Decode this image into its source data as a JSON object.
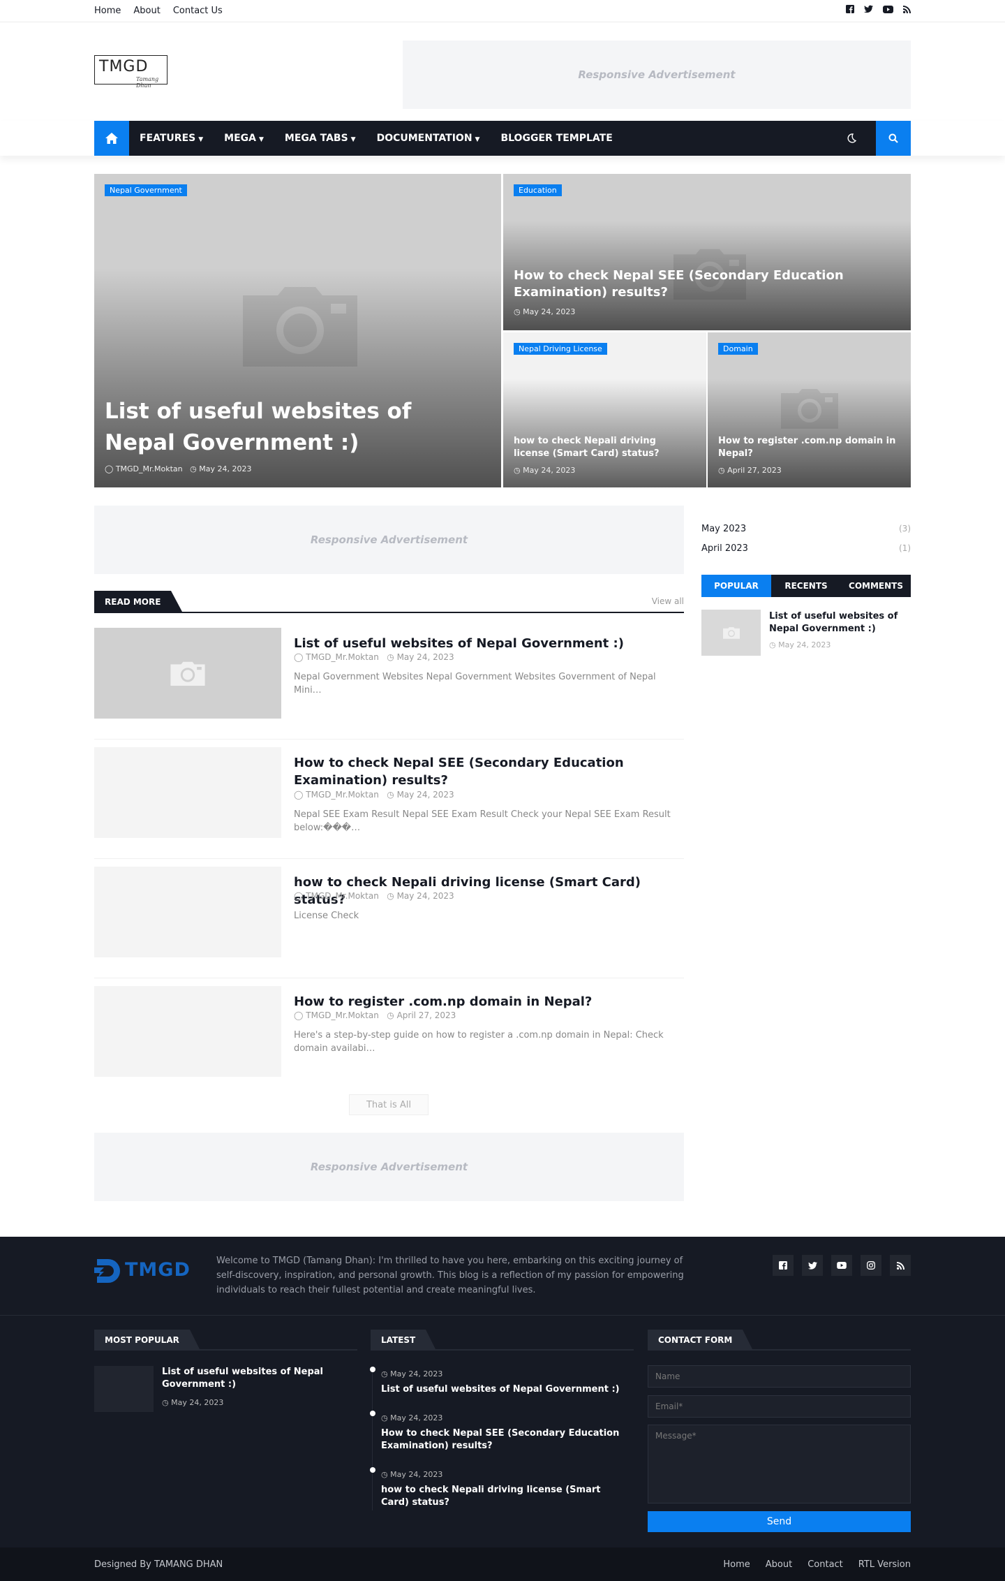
{
  "topbar": {
    "links": [
      "Home",
      "About",
      "Contact Us"
    ],
    "social": [
      "facebook-icon",
      "twitter-icon",
      "youtube-icon",
      "rss-icon"
    ]
  },
  "header": {
    "logo_text": "TMGD",
    "logo_script": "Tamang Dhan",
    "ad_text": "Responsive Advertisement"
  },
  "nav": {
    "items": [
      {
        "label": "FEATURES",
        "dropdown": true
      },
      {
        "label": "MEGA",
        "dropdown": true
      },
      {
        "label": "MEGA TABS",
        "dropdown": true
      },
      {
        "label": "DOCUMENTATION",
        "dropdown": true
      },
      {
        "label": "BLOGGER TEMPLATE",
        "dropdown": false
      }
    ],
    "accent": "#0a7ff0"
  },
  "featured": [
    {
      "label": "Nepal Government",
      "title": "List of useful websites of Nepal Government :)",
      "author": "TMGD_Mr.Moktan",
      "date": "May 24, 2023"
    },
    {
      "label": "Education",
      "title": "How to check Nepal SEE (Secondary Education Examination) results?",
      "date": "May 24, 2023"
    },
    {
      "label": "Nepal Driving License",
      "title": "how to check Nepali driving license (Smart Card) status?",
      "date": "May 24, 2023"
    },
    {
      "label": "Domain",
      "title": "How to register .com.np domain in Nepal?",
      "date": "April 27, 2023"
    }
  ],
  "main": {
    "ad_text": "Responsive Advertisement",
    "section_title": "READ MORE",
    "view_all": "View all",
    "posts": [
      {
        "title": "List of useful websites of Nepal Government :)",
        "author": "TMGD_Mr.Moktan",
        "date": "May 24, 2023",
        "snippet": "Nepal Government Websites Nepal Government Websites Government of Nepal Mini…"
      },
      {
        "title": "How to check Nepal SEE (Secondary Education Examination) results?",
        "author": "TMGD_Mr.Moktan",
        "date": "May 24, 2023",
        "snippet": "Nepal SEE Exam Result Nepal SEE Exam Result Check your Nepal SEE Exam Result below:���…"
      },
      {
        "title": "how to check Nepali driving license (Smart Card) status?",
        "author": "TMGD_Mr.Moktan",
        "date": "May 24, 2023",
        "snippet": "License Check"
      },
      {
        "title": "How to register .com.np domain in Nepal?",
        "author": "TMGD_Mr.Moktan",
        "date": "April 27, 2023",
        "snippet": "Here's a step-by-step guide on how to register a .com.np domain in Nepal: Check domain availabi…"
      }
    ],
    "more_label": "That is All"
  },
  "sidebar": {
    "archive": [
      {
        "label": "May 2023",
        "count": "(3)"
      },
      {
        "label": "April 2023",
        "count": "(1)"
      }
    ],
    "tabs": [
      "POPULAR",
      "RECENTS",
      "COMMENTS"
    ],
    "popular_post": {
      "title": "List of useful websites of Nepal Government :)",
      "date": "May 24, 2023"
    }
  },
  "footer": {
    "about": "Welcome to TMGD (Tamang Dhan): I'm thrilled to have you here, embarking on this exciting journey of self-discovery, inspiration, and personal growth. This blog is a reflection of my passion for empowering individuals to reach their fullest potential and create meaningful lives.",
    "logo_text": "TMGD",
    "social": [
      "facebook-icon",
      "twitter-icon",
      "youtube-icon",
      "instagram-icon",
      "rss-icon"
    ],
    "most_popular_title": "MOST POPULAR",
    "most_popular": {
      "title": "List of useful websites of Nepal Government :)",
      "date": "May 24, 2023"
    },
    "latest_title": "LATEST",
    "latest": [
      {
        "date": "May 24, 2023",
        "title": "List of useful websites of Nepal Government :)"
      },
      {
        "date": "May 24, 2023",
        "title": "How to check Nepal SEE (Secondary Education Examination) results?"
      },
      {
        "date": "May 24, 2023",
        "title": "how to check Nepali driving license (Smart Card) status?"
      }
    ],
    "contact_title": "CONTACT FORM",
    "contact": {
      "name_ph": "Name",
      "email_ph": "Email*",
      "message_ph": "Message*",
      "send": "Send"
    }
  },
  "bottom": {
    "credit": "Designed By TAMANG DHAN",
    "links": [
      "Home",
      "About",
      "Contact",
      "RTL Version"
    ]
  }
}
